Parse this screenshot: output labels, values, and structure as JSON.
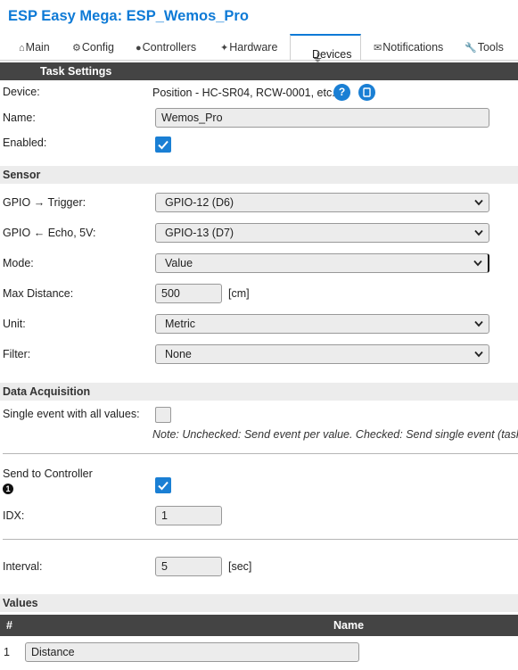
{
  "app": {
    "title": "ESP Easy Mega: ESP_Wemos_Pro"
  },
  "tabs": [
    {
      "label": "Main",
      "icon": "house-icon"
    },
    {
      "label": "Config",
      "icon": "gear-icon"
    },
    {
      "label": "Controllers",
      "icon": "speech-bubble-icon"
    },
    {
      "label": "Hardware",
      "icon": "pin-icon"
    },
    {
      "label": "Devices",
      "icon": "plug-icon",
      "active": true
    },
    {
      "label": "Notifications",
      "icon": "envelope-icon"
    },
    {
      "label": "Tools",
      "icon": "wrench-icon"
    }
  ],
  "task_settings": {
    "header": "Task Settings",
    "device_label": "Device:",
    "device_value": "Position - HC-SR04, RCW-0001, etc.",
    "name_label": "Name:",
    "name_value": "Wemos_Pro",
    "enabled_label": "Enabled:",
    "enabled": true
  },
  "sensor": {
    "header": "Sensor",
    "trigger_label": "GPIO → Trigger:",
    "trigger_value": "GPIO-12 (D6)",
    "echo_label": "GPIO ← Echo, 5V:",
    "echo_value": "GPIO-13 (D7)",
    "mode_label": "Mode:",
    "mode_value": "Value",
    "maxdist_label": "Max Distance:",
    "maxdist_value": "500",
    "maxdist_unit": "[cm]",
    "unit_label": "Unit:",
    "unit_value": "Metric",
    "filter_label": "Filter:",
    "filter_value": "None"
  },
  "data_acquisition": {
    "header": "Data Acquisition",
    "single_event_label": "Single event with all values:",
    "single_event": false,
    "note": "Note: Unchecked: Send event per value. Checked: Send single event (taskna",
    "send_label": "Send to Controller",
    "send_enabled": true,
    "idx_label": "IDX:",
    "idx_value": "1",
    "interval_label": "Interval:",
    "interval_value": "5",
    "interval_unit": "[sec]"
  },
  "values": {
    "header": "Values",
    "col_num": "#",
    "col_name": "Name",
    "rows": [
      {
        "num": "1",
        "name": "Distance"
      }
    ]
  },
  "colors": {
    "accent": "#0e7ad6",
    "checkbox": "#1a7fd4",
    "header_bar": "#444444",
    "section_bg": "#ececec"
  }
}
